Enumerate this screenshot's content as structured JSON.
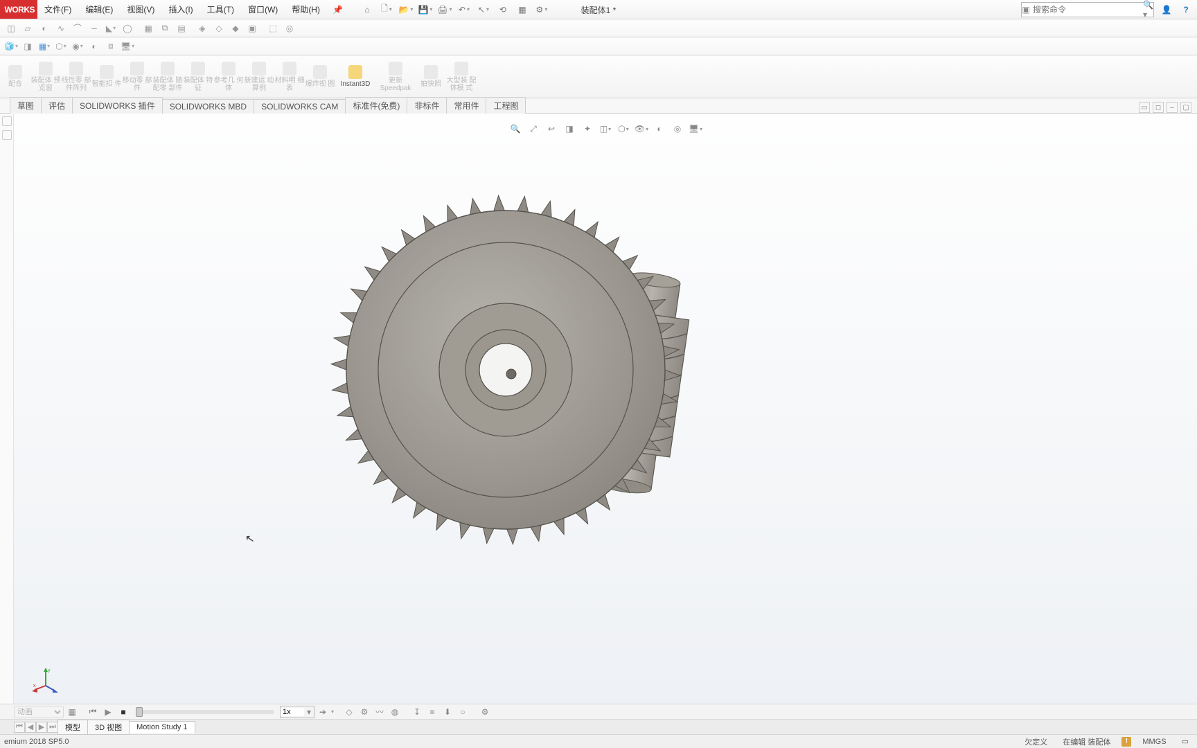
{
  "app": {
    "logo": "WORKS",
    "document_title": "装配体1 *",
    "search_placeholder": "搜索命令",
    "version": "emium 2018 SP5.0"
  },
  "menu": {
    "items": [
      "文件(F)",
      "编辑(E)",
      "视图(V)",
      "插入(I)",
      "工具(T)",
      "窗口(W)",
      "帮助(H)"
    ]
  },
  "qa": {
    "icons": [
      "home-icon",
      "new-icon",
      "open-icon",
      "save-icon",
      "print-icon",
      "undo-icon",
      "select-icon",
      "rebuild-icon",
      "options-icon",
      "settings-icon"
    ]
  },
  "toolbar_rows": {
    "row1": [
      "sketch-icon",
      "draft-icon",
      "surface-icon",
      "sweep-icon",
      "curve-icon",
      "spline-icon",
      "chamfer-icon",
      "hole-icon",
      "pattern-icon",
      "mirror-icon",
      "ref-icon",
      "eval-icon",
      "d1-icon",
      "d2-icon",
      "d3-icon",
      "d4-icon",
      "d5-icon"
    ],
    "row2": [
      "gview-icon",
      "section-icon",
      "box-icon",
      "view-icon",
      "show-icon",
      "style-icon",
      "model-icon",
      "disp-icon"
    ]
  },
  "ribbon": {
    "items": [
      {
        "label": "配合",
        "enabled": false
      },
      {
        "label": "装配体\n预览窗",
        "enabled": false
      },
      {
        "label": "线性零\n部件阵列",
        "enabled": false
      },
      {
        "label": "智能扣\n件",
        "enabled": false
      },
      {
        "label": "移动零\n部件",
        "enabled": false
      },
      {
        "label": "装配体\n随配零\n部件",
        "enabled": false
      },
      {
        "label": "装配体\n特征",
        "enabled": false
      },
      {
        "label": "参考几\n何体",
        "enabled": false
      },
      {
        "label": "新建运\n动算例",
        "enabled": false
      },
      {
        "label": "材料明\n细表",
        "enabled": false
      },
      {
        "label": "爆炸视\n图",
        "enabled": false
      },
      {
        "label": "Instant3D",
        "enabled": true
      },
      {
        "label": "更新\nSpeedpak",
        "enabled": false
      },
      {
        "label": "拍快照",
        "enabled": false
      },
      {
        "label": "大型装\n配体模\n式",
        "enabled": false
      }
    ]
  },
  "cm_tabs": {
    "items": [
      "草图",
      "评估",
      "SOLIDWORKS 插件",
      "SOLIDWORKS MBD",
      "SOLIDWORKS CAM",
      "标准件(免费)",
      "非标件",
      "常用件",
      "工程图"
    ]
  },
  "hud": {
    "icons": [
      "zoom-fit-icon",
      "zoom-area-icon",
      "prev-view-icon",
      "section-view-icon",
      "dynamic-icon",
      "display-style-icon",
      "hide-show-icon",
      "appearance-icon",
      "scene-icon",
      "view-settings-icon",
      "render-icon"
    ]
  },
  "motion": {
    "mode": "动画",
    "speed": "1x",
    "play_icons": [
      "calc-icon",
      "play-start-icon",
      "play-icon",
      "stop-icon"
    ],
    "right_icons": [
      "arrow-icon",
      "key-icon",
      "motor-icon",
      "spring-icon",
      "contact-icon",
      "force-icon",
      "result-icon",
      "gravity-icon",
      "plot-icon",
      "opts-icon"
    ]
  },
  "model_tabs": {
    "items": [
      "模型",
      "3D 视图",
      "Motion Study 1"
    ]
  },
  "status": {
    "right": [
      "欠定义",
      "在编辑 装配体",
      "MMGS"
    ]
  }
}
